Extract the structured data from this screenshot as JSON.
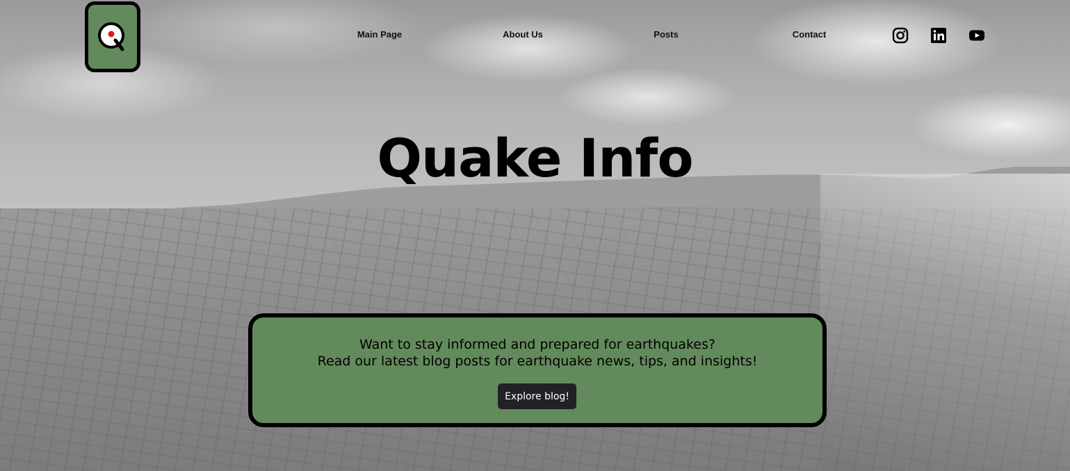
{
  "header": {
    "logo_icon": "quake-q-logo-icon",
    "nav": [
      {
        "label": "Main Page"
      },
      {
        "label": "About Us"
      },
      {
        "label": "Posts"
      },
      {
        "label": "Contact"
      }
    ],
    "social": [
      {
        "icon": "instagram-icon"
      },
      {
        "icon": "linkedin-icon"
      },
      {
        "icon": "youtube-icon"
      }
    ]
  },
  "hero": {
    "title": "Quake Info",
    "background": "grayscale-aerial-city-photo"
  },
  "cta": {
    "line1": "Want to stay informed and prepared for earthquakes?",
    "line2": "Read our latest blog posts for earthquake news, tips, and insights!",
    "button_label": "Explore blog!"
  },
  "colors": {
    "accent_green": "#638a5c",
    "button_dark": "#222226",
    "logo_dot_red": "#d62020"
  }
}
